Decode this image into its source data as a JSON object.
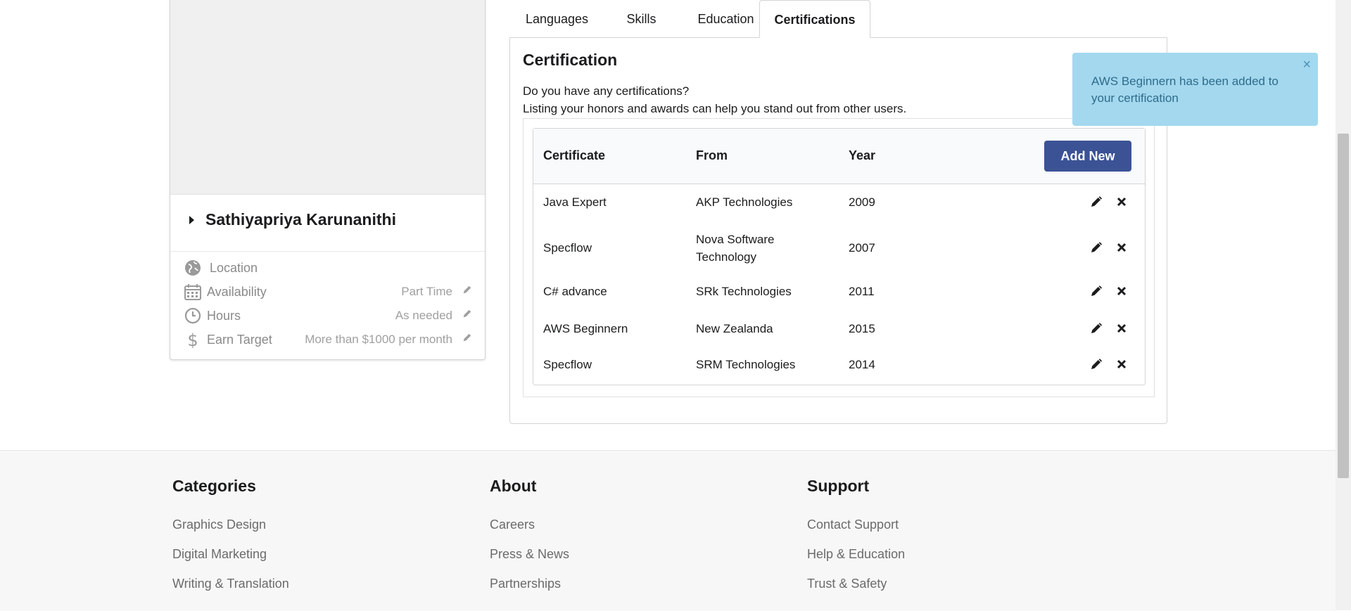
{
  "profile": {
    "name": "Sathiyapriya Karunanithi",
    "fields": [
      {
        "icon": "globe-icon",
        "label": "Location",
        "value": ""
      },
      {
        "icon": "calendar-icon",
        "label": "Availability",
        "value": "Part Time"
      },
      {
        "icon": "clock-icon",
        "label": "Hours",
        "value": "As needed"
      },
      {
        "icon": "dollar-icon",
        "label": "Earn Target",
        "value": "More than $1000 per month"
      }
    ]
  },
  "tabs": [
    {
      "label": "Languages",
      "active": false
    },
    {
      "label": "Skills",
      "active": false
    },
    {
      "label": "Education",
      "active": false
    },
    {
      "label": "Certifications",
      "active": true
    }
  ],
  "certification": {
    "title": "Certification",
    "question": "Do you have any certifications?",
    "description": "Listing your honors and awards can help you stand out from other users.",
    "columns": [
      "Certificate",
      "From",
      "Year"
    ],
    "add_new_label": "Add New",
    "rows": [
      {
        "certificate": "Java Expert",
        "from": "AKP Technologies",
        "year": "2009"
      },
      {
        "certificate": "Specflow",
        "from": "Nova Software Technology",
        "year": "2007"
      },
      {
        "certificate": "C# advance",
        "from": "SRk Technologies",
        "year": "2011"
      },
      {
        "certificate": "AWS Beginnern",
        "from": "New Zealanda",
        "year": "2015"
      },
      {
        "certificate": "Specflow",
        "from": "SRM Technologies",
        "year": "2014"
      }
    ]
  },
  "toast": {
    "message": "AWS Beginnern has been added to your certification",
    "close_symbol": "×",
    "color": "#a3d8ef"
  },
  "footer": {
    "columns": [
      {
        "heading": "Categories",
        "links": [
          "Graphics Design",
          "Digital Marketing",
          "Writing & Translation"
        ]
      },
      {
        "heading": "About",
        "links": [
          "Careers",
          "Press & News",
          "Partnerships"
        ]
      },
      {
        "heading": "Support",
        "links": [
          "Contact Support",
          "Help & Education",
          "Trust & Safety"
        ]
      }
    ]
  },
  "colors": {
    "primary_button": "#3b5295",
    "toast_bg": "#a3d8ef"
  }
}
